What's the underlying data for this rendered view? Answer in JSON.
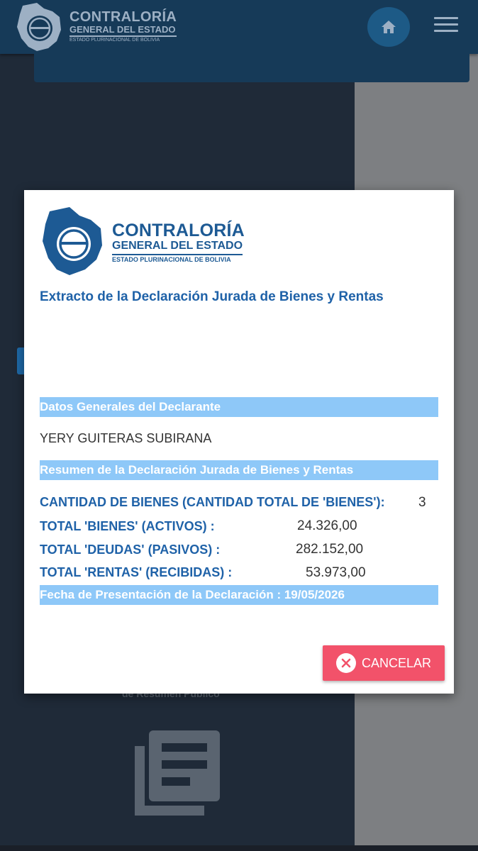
{
  "header": {
    "brand_line1": "CONTRALORÍA",
    "brand_line2": "GENERAL DEL ESTADO",
    "brand_line3": "ESTADO PLURINACIONAL DE BOLIVIA",
    "home_icon": "home-icon",
    "menu_icon": "hamburger-menu-icon"
  },
  "background": {
    "caption": "de Resumen Público",
    "doc_icon": "document-list-icon"
  },
  "modal": {
    "brand_line1": "CONTRALORÍA",
    "brand_line2": "GENERAL DEL ESTADO",
    "brand_line3": "ESTADO PLURINACIONAL DE BOLIVIA",
    "title": "Extracto de la Declaración Jurada de Bienes y Rentas",
    "section_general": "Datos Generales del Declarante",
    "declarant_name": "YERY GUITERAS SUBIRANA",
    "section_summary": "Resumen de la Declaración Jurada de Bienes y Rentas",
    "rows": [
      {
        "label": "CANTIDAD DE BIENES (CANTIDAD TOTAL DE 'BIENES'):",
        "value": "3"
      },
      {
        "label": "TOTAL 'BIENES' (ACTIVOS) :",
        "value": "24.326,00"
      },
      {
        "label": "TOTAL 'DEUDAS' (PASIVOS) :",
        "value": "282.152,00"
      },
      {
        "label": "TOTAL 'RENTAS' (RECIBIDAS) :",
        "value": "53.973,00"
      }
    ],
    "date_line": "Fecha de Presentación de la Declaración : 19/05/2026",
    "cancel_label": "CANCELAR",
    "cancel_icon": "close-circle-icon"
  },
  "colors": {
    "header_bg": "#163a58",
    "accent_blue": "#1f62a8",
    "band_blue": "#8ec8f8",
    "cancel_red": "#f2526a"
  }
}
